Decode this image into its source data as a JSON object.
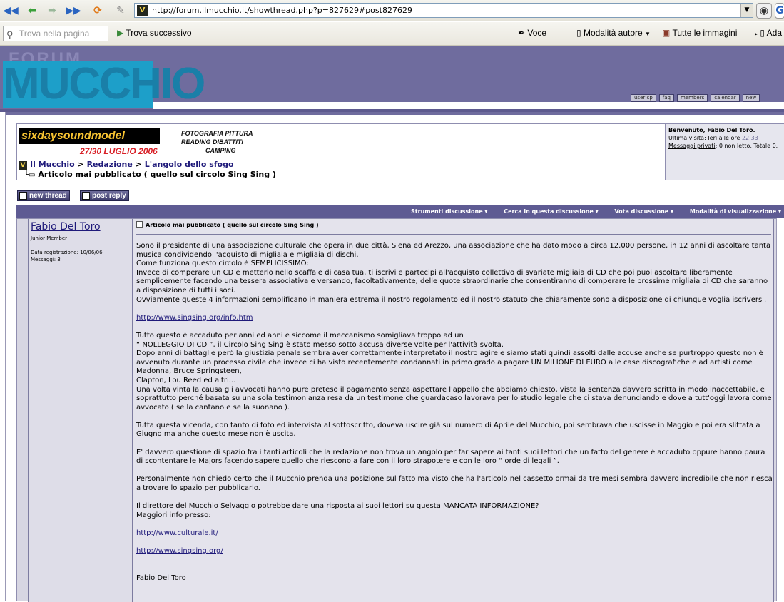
{
  "browser": {
    "url": "http://forum.ilmucchio.it/showthread.php?p=827629#post827629",
    "favicon_letter": "V",
    "find_placeholder": "Trova nella pagina",
    "find_next": "Trova successivo",
    "voice": "Voce",
    "author_mode": "Modalità autore",
    "all_images": "Tutte le immagini",
    "truncated_item": "Ada",
    "icons": [
      "back-icon",
      "forward-icon",
      "forward-green-icon",
      "fast-forward-icon",
      "reload-icon",
      "edit-icon",
      "search-icon",
      "play-icon",
      "pen-icon",
      "page-icon",
      "images-icon"
    ]
  },
  "header": {
    "logo_top": "FORUM",
    "logo_main": "MUCCHIO",
    "nav": [
      "user cp",
      "faq",
      "members",
      "calendar",
      "new"
    ]
  },
  "banner": {
    "logo_text": "sixdaysoundmodel",
    "date": "27/30 LUGLIO 2006",
    "line1": "FOTOGRAFIA  PITTURA",
    "line2": "READING   DIBATTITI",
    "line3": "CAMPING"
  },
  "breadcrumb": {
    "home": "Il Mucchio",
    "sep": ">",
    "level2": "Redazione",
    "level3": "L'angolo dello sfogo",
    "current": "Articolo mai pubblicato ( quello sul circolo Sing Sing )"
  },
  "userbox": {
    "welcome": "Benvenuto, Fabio Del Toro.",
    "last_visit_label": "Ultima visita: Ieri alle ore",
    "last_visit_time": "22.33",
    "pm_label": "Messaggi privati",
    "pm_text": ": 0 non letto, Totale 0."
  },
  "actions": {
    "new_thread": "new thread",
    "post_reply": "post reply"
  },
  "thread_tools": [
    "Strumenti discussione",
    "Cerca in questa discussione",
    "Vota discussione",
    "Modalità di visualizzazione"
  ],
  "post": {
    "author": "Fabio Del Toro",
    "rank": "Junior Member",
    "reg_date": "Data registrazione: 10/06/06",
    "messages": "Messaggi: 3",
    "title": "Articolo mai pubblicato ( quello sul circolo Sing Sing )",
    "p1": "Sono il presidente di una associazione culturale che opera in due città, Siena ed Arezzo, una associazione che ha dato modo a circa 12.000 persone, in 12 anni di ascoltare tanta musica condividendo l'acquisto di migliaia e migliaia di dischi.",
    "p1b": "Come funziona questo circolo è SEMPLICISSIMO:",
    "p1c": "Invece di comperare un CD e metterlo nello scaffale di casa tua, ti iscrivi e partecipi all'acquisto collettivo di svariate migliaia di CD che poi puoi ascoltare liberamente semplicemente facendo una tessera associativa e versando, facoltativamente, delle quote straordinarie che consentiranno di comperare le prossime migliaia di CD che saranno a disposizione di tutti i soci.",
    "p1d": "Ovviamente queste 4 informazioni semplificano in maniera estrema il nostro regolamento ed il nostro statuto che chiaramente sono a disposizione di chiunque voglia iscriversi.",
    "link1": "http://www.singsing.org/info.htm",
    "p2": "Tutto questo è accaduto per anni ed anni e siccome il meccanismo somigliava troppo ad un",
    "p2b": "“ NOLLEGGIO DI CD ”, il Circolo Sing Sing è stato messo sotto accusa diverse volte per l'attività svolta.",
    "p2c": "Dopo anni di battaglie però la giustizia penale sembra aver correttamente interpretato il nostro agire e siamo stati quindi assolti dalle accuse anche se purtroppo questo non è avvenuto durante un processo civile che invece ci ha visto recentemente condannati in primo grado a pagare UN MILIONE DI EURO alle case discografiche e ad artisti come Madonna, Bruce Springsteen,",
    "p2d": "Clapton, Lou Reed ed altri...",
    "p2e": "Una volta vinta la causa gli avvocati hanno pure preteso il pagamento senza aspettare l'appello che abbiamo chiesto, vista la sentenza davvero scritta in modo inaccettabile, e soprattutto perché basata su una sola testimonianza resa da un testimone che guardacaso lavorava per lo studio legale che ci stava denunciando e dove a tutt'oggi lavora come avvocato ( se la cantano e se la suonano ).",
    "p3": "Tutta questa vicenda, con tanto di foto ed intervista al sottoscritto, doveva uscire già sul numero di Aprile del Mucchio, poi sembrava che uscisse in Maggio e poi era slittata a Giugno ma anche questo mese non è uscita.",
    "p4": "E' davvero questione di spazio fra i tanti articoli che la redazione non trova un angolo per far sapere ai tanti suoi lettori che un fatto del genere è accaduto oppure hanno paura di scontentare le Majors facendo sapere quello che riescono a fare con il loro strapotere e con le loro “ orde di legali ”.",
    "p5": "Personalmente non chiedo certo che il Mucchio prenda una posizione sul fatto ma visto che ha l'articolo nel cassetto ormai da tre mesi sembra davvero incredibile che non riesca a trovare lo spazio per pubblicarlo.",
    "p6": "Il direttore del Mucchio Selvaggio potrebbe dare una risposta ai suoi lettori su questa MANCATA INFORMAZIONE?",
    "p6b": "Maggiori info presso:",
    "link2": "http://www.culturale.it/",
    "link3": "http://www.singsing.org/",
    "signature": "Fabio Del Toro"
  },
  "colors": {
    "header_bg": "#6f6c9e",
    "logo_blue": "#1d9fc9",
    "link": "#1f1a7a",
    "post_bg": "#e4e3ec"
  }
}
